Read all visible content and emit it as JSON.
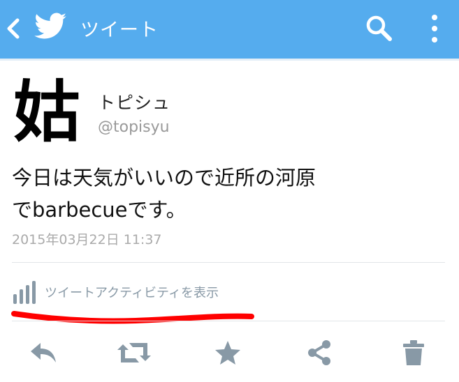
{
  "header": {
    "title": "ツイート",
    "bar_color": "#55acee",
    "icons": [
      "back-arrow-icon",
      "twitter-bird-icon",
      "search-icon",
      "more-vertical-icon"
    ]
  },
  "tweet": {
    "avatar_glyph": "姑",
    "display_name": "トピシュ",
    "handle": "@topisyu",
    "text_line1": "今日は天気がいいので近所の河原",
    "text_line2": "でbarbecueです。",
    "timestamp": "2015年03月22日 11:37"
  },
  "activity": {
    "label": "ツイートアクティビティを表示",
    "annotation_color": "#ff0000"
  },
  "actions": [
    "reply-icon",
    "retweet-icon",
    "favorite-star-icon",
    "share-icon",
    "delete-trash-icon"
  ]
}
